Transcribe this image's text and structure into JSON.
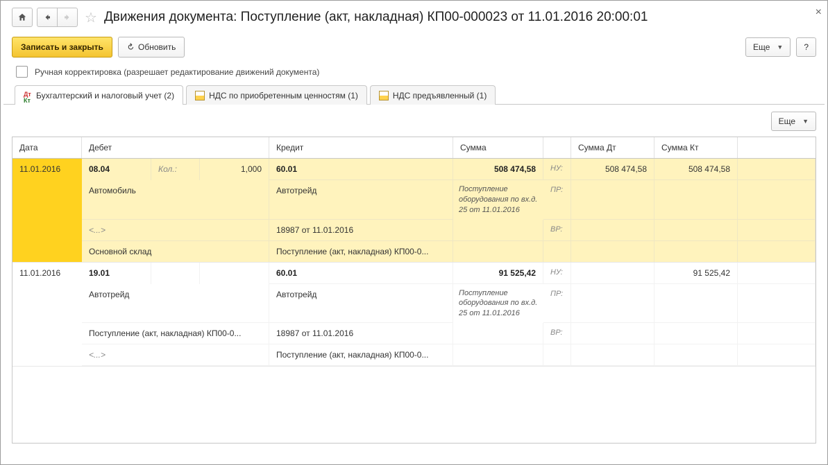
{
  "window": {
    "title": "Движения документа: Поступление (акт, накладная) КП00-000023 от 11.01.2016 20:00:01"
  },
  "toolbar": {
    "save_close_label": "Записать и закрыть",
    "refresh_label": "Обновить",
    "more_label": "Еще",
    "help_label": "?"
  },
  "manual_edit": {
    "label": "Ручная корректировка (разрешает редактирование движений документа)",
    "checked": false
  },
  "tabs": [
    {
      "id": "accounting",
      "label": "Бухгалтерский и налоговый учет (2)",
      "active": true,
      "icon": "kt"
    },
    {
      "id": "vat_acq",
      "label": "НДС по приобретенным ценностям (1)",
      "active": false,
      "icon": "sheet"
    },
    {
      "id": "vat_pres",
      "label": "НДС предъявленный (1)",
      "active": false,
      "icon": "sheet"
    }
  ],
  "tab_toolbar": {
    "more_label": "Еще"
  },
  "ledger_headers": {
    "date": "Дата",
    "debit": "Дебет",
    "credit": "Кредит",
    "sum": "Сумма",
    "sum_dt": "Сумма Дт",
    "sum_kt": "Сумма Кт"
  },
  "row_tags": {
    "nu": "НУ:",
    "pr": "ПР:",
    "vr": "ВР:"
  },
  "qty_label": "Кол.:",
  "placeholder_empty": "<...>",
  "entries": [
    {
      "highlight": true,
      "date": "11.01.2016",
      "debit_acct": "08.04",
      "qty": "1,000",
      "credit_acct": "60.01",
      "sum": "508 474,58",
      "sum_dt": "508 474,58",
      "sum_kt": "508 474,58",
      "description": "Поступление оборудования по вх.д. 25 от 11.01.2016",
      "debit_lines": [
        "Автомобиль",
        "<...>",
        "Основной склад"
      ],
      "credit_lines": [
        "Автотрейд",
        "18987 от 11.01.2016",
        "Поступление (акт, накладная) КП00-0..."
      ]
    },
    {
      "highlight": false,
      "date": "11.01.2016",
      "debit_acct": "19.01",
      "qty": "",
      "credit_acct": "60.01",
      "sum": "91 525,42",
      "sum_dt": "",
      "sum_kt": "91 525,42",
      "description": "Поступление оборудования по вх.д. 25 от 11.01.2016",
      "debit_lines": [
        "Автотрейд",
        "Поступление (акт, накладная) КП00-0...",
        "<...>"
      ],
      "credit_lines": [
        "Автотрейд",
        "18987 от 11.01.2016",
        "Поступление (акт, накладная) КП00-0..."
      ]
    }
  ]
}
